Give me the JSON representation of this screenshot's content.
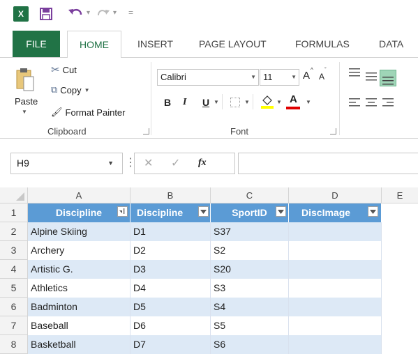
{
  "qat": {
    "logo": "X",
    "undo_arrow": "▾",
    "redo_arrow": "▾",
    "customize": "="
  },
  "tabs": [
    {
      "label": "FILE"
    },
    {
      "label": "HOME"
    },
    {
      "label": "INSERT"
    },
    {
      "label": "PAGE LAYOUT"
    },
    {
      "label": "FORMULAS"
    },
    {
      "label": "DATA"
    }
  ],
  "clipboard": {
    "paste_label": "Paste",
    "cut_label": "Cut",
    "copy_label": "Copy",
    "format_painter_label": "Format Painter",
    "group_label": "Clipboard"
  },
  "font": {
    "name": "Calibri",
    "size": "11",
    "group_label": "Font",
    "bold": "B",
    "italic": "I",
    "underline": "U",
    "grow": "A",
    "shrink": "A",
    "font_color_letter": "A"
  },
  "formula_bar": {
    "cell_ref": "H9",
    "fx": "fx",
    "value": ""
  },
  "grid": {
    "columns": [
      "A",
      "B",
      "C",
      "D",
      "E"
    ],
    "rows": [
      "1",
      "2",
      "3",
      "4",
      "5",
      "6",
      "7",
      "8"
    ],
    "headers": [
      "Discipline",
      "Discipline",
      "SportID",
      "DiscImage"
    ],
    "data": [
      [
        "Alpine Skiing",
        "D1",
        "S37",
        ""
      ],
      [
        "Archery",
        "D2",
        "S2",
        ""
      ],
      [
        "Artistic G.",
        "D3",
        "S20",
        ""
      ],
      [
        "Athletics",
        "D4",
        "S3",
        ""
      ],
      [
        "Badminton",
        "D5",
        "S4",
        ""
      ],
      [
        "Baseball",
        "D6",
        "S5",
        ""
      ],
      [
        "Basketball",
        "D7",
        "S6",
        ""
      ]
    ]
  },
  "colors": {
    "accent": "#217346",
    "table_header": "#5b9bd5",
    "band": "#dde9f6",
    "font_color_bar": "#e00000",
    "highlight_bar": "#ffff00"
  }
}
